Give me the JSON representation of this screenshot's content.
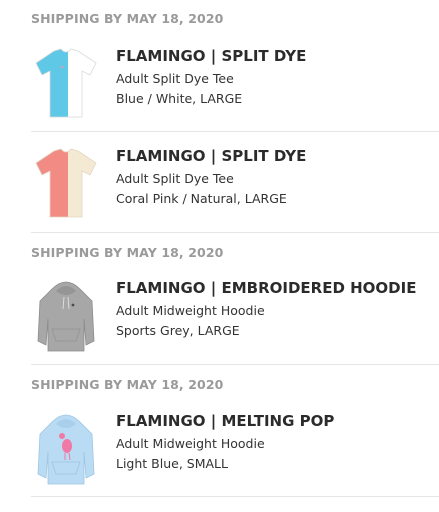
{
  "groups": [
    {
      "header": "SHIPPING BY MAY 18, 2020",
      "items": [
        {
          "title": "FLAMINGO | SPLIT DYE",
          "subtitle": "Adult Split Dye Tee",
          "variant": "Blue / White, LARGE",
          "thumb": "split-dye-tee-blue-white"
        },
        {
          "title": "FLAMINGO | SPLIT DYE",
          "subtitle": "Adult Split Dye Tee",
          "variant": "Coral Pink / Natural, LARGE",
          "thumb": "split-dye-tee-coral-natural"
        }
      ]
    },
    {
      "header": "SHIPPING BY MAY 18, 2020",
      "items": [
        {
          "title": "FLAMINGO | EMBROIDERED HOODIE",
          "subtitle": "Adult Midweight Hoodie",
          "variant": "Sports Grey, LARGE",
          "thumb": "hoodie-sports-grey"
        }
      ]
    },
    {
      "header": "SHIPPING BY MAY 18, 2020",
      "items": [
        {
          "title": "FLAMINGO | MELTING POP",
          "subtitle": "Adult Midweight Hoodie",
          "variant": "Light Blue, SMALL",
          "thumb": "hoodie-light-blue-melting-pop"
        }
      ]
    }
  ],
  "colors": {
    "header_text": "#9a9a9a",
    "title_text": "#2b2b2b",
    "divider": "#e6e6e6",
    "tee_blue": "#5ec8e6",
    "tee_white": "#ffffff",
    "tee_coral": "#f28b83",
    "tee_natural": "#f4ead3",
    "hoodie_grey": "#a7a7a7",
    "hoodie_light_blue": "#b9dbf3",
    "flamingo_pink": "#f07aa6"
  }
}
